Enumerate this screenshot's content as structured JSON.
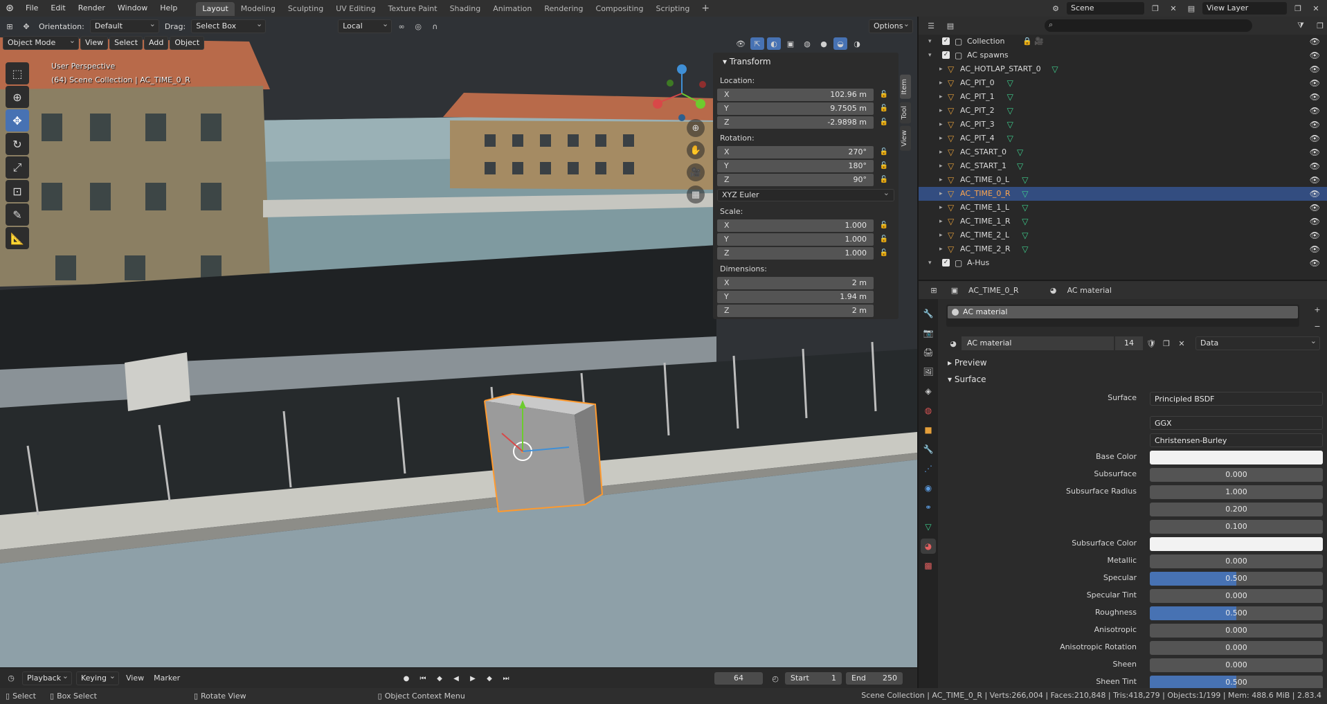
{
  "topbar": {
    "menus": [
      "File",
      "Edit",
      "Render",
      "Window",
      "Help"
    ],
    "workspaces": [
      "Layout",
      "Modeling",
      "Sculpting",
      "UV Editing",
      "Texture Paint",
      "Shading",
      "Animation",
      "Rendering",
      "Compositing",
      "Scripting"
    ],
    "active_workspace": "Layout",
    "scene": "Scene",
    "view_layer": "View Layer"
  },
  "viewport": {
    "orientation_label": "Orientation:",
    "orientation_value": "Default",
    "drag_label": "Drag:",
    "drag_value": "Select Box",
    "transform_space": "Local",
    "options": "Options",
    "mode": "Object Mode",
    "menus": [
      "View",
      "Select",
      "Add",
      "Object"
    ],
    "info_line1": "User Perspective",
    "info_line2": "(64) Scene Collection | AC_TIME_0_R"
  },
  "transform": {
    "title": "Transform",
    "location_label": "Location:",
    "location": {
      "x": "102.96 m",
      "y": "9.7505 m",
      "z": "-2.9898 m"
    },
    "rotation_label": "Rotation:",
    "rotation": {
      "x": "270°",
      "y": "180°",
      "z": "90°"
    },
    "rotation_mode": "XYZ Euler",
    "scale_label": "Scale:",
    "scale": {
      "x": "1.000",
      "y": "1.000",
      "z": "1.000"
    },
    "dimensions_label": "Dimensions:",
    "dimensions": {
      "x": "2 m",
      "y": "1.94 m",
      "z": "2 m"
    },
    "axes": {
      "x": "X",
      "y": "Y",
      "z": "Z"
    },
    "side_tabs": [
      "Item",
      "Tool",
      "View"
    ]
  },
  "timeline": {
    "menus": [
      "Playback",
      "Keying",
      "View",
      "Marker"
    ],
    "current_frame": "64",
    "start_label": "Start",
    "start": "1",
    "end_label": "End",
    "end": "250"
  },
  "statusbar": {
    "select": "Select",
    "box_select": "Box Select",
    "rotate_view": "Rotate View",
    "context_menu": "Object Context Menu",
    "stats": "Scene Collection | AC_TIME_0_R | Verts:266,004 | Faces:210,848 | Tris:418,279 | Objects:1/199 | Mem: 488.6 MiB | 2.83.4"
  },
  "outliner": {
    "rows": [
      {
        "name": "Collection",
        "kind": "collection",
        "indent": 0,
        "selected": false
      },
      {
        "name": "AC spawns",
        "kind": "collection",
        "indent": 0,
        "selected": false
      },
      {
        "name": "AC_HOTLAP_START_0",
        "kind": "object",
        "indent": 1,
        "selected": false
      },
      {
        "name": "AC_PIT_0",
        "kind": "object",
        "indent": 1,
        "selected": false
      },
      {
        "name": "AC_PIT_1",
        "kind": "object",
        "indent": 1,
        "selected": false
      },
      {
        "name": "AC_PIT_2",
        "kind": "object",
        "indent": 1,
        "selected": false
      },
      {
        "name": "AC_PIT_3",
        "kind": "object",
        "indent": 1,
        "selected": false
      },
      {
        "name": "AC_PIT_4",
        "kind": "object",
        "indent": 1,
        "selected": false
      },
      {
        "name": "AC_START_0",
        "kind": "object",
        "indent": 1,
        "selected": false
      },
      {
        "name": "AC_START_1",
        "kind": "object",
        "indent": 1,
        "selected": false
      },
      {
        "name": "AC_TIME_0_L",
        "kind": "object",
        "indent": 1,
        "selected": false
      },
      {
        "name": "AC_TIME_0_R",
        "kind": "object",
        "indent": 1,
        "selected": true
      },
      {
        "name": "AC_TIME_1_L",
        "kind": "object",
        "indent": 1,
        "selected": false
      },
      {
        "name": "AC_TIME_1_R",
        "kind": "object",
        "indent": 1,
        "selected": false
      },
      {
        "name": "AC_TIME_2_L",
        "kind": "object",
        "indent": 1,
        "selected": false
      },
      {
        "name": "AC_TIME_2_R",
        "kind": "object",
        "indent": 1,
        "selected": false
      },
      {
        "name": "A-Hus",
        "kind": "collection",
        "indent": 0,
        "selected": false
      }
    ]
  },
  "properties": {
    "object_name": "AC_TIME_0_R",
    "material_name": "AC material",
    "slot_name": "AC material",
    "material_field": "AC material",
    "users": "14",
    "link": "Data",
    "preview": "Preview",
    "surface_panel": "Surface",
    "rows": [
      {
        "label": "Surface",
        "value": "Principled BSDF",
        "style": "dark"
      },
      {
        "label": "",
        "value": "GGX",
        "style": "dark"
      },
      {
        "label": "",
        "value": "Christensen-Burley",
        "style": "dark"
      },
      {
        "label": "Base Color",
        "value": "",
        "style": "white"
      },
      {
        "label": "Subsurface",
        "value": "0.000",
        "style": "num",
        "fill": 0
      },
      {
        "label": "Subsurface Radius",
        "value": "1.000",
        "style": "num",
        "fill": 0
      },
      {
        "label": "",
        "value": "0.200",
        "style": "num",
        "fill": 0
      },
      {
        "label": "",
        "value": "0.100",
        "style": "num",
        "fill": 0
      },
      {
        "label": "Subsurface Color",
        "value": "",
        "style": "white"
      },
      {
        "label": "Metallic",
        "value": "0.000",
        "style": "num",
        "fill": 0
      },
      {
        "label": "Specular",
        "value": "0.500",
        "style": "num",
        "fill": 0.5
      },
      {
        "label": "Specular Tint",
        "value": "0.000",
        "style": "num",
        "fill": 0
      },
      {
        "label": "Roughness",
        "value": "0.500",
        "style": "num",
        "fill": 0.5
      },
      {
        "label": "Anisotropic",
        "value": "0.000",
        "style": "num",
        "fill": 0
      },
      {
        "label": "Anisotropic Rotation",
        "value": "0.000",
        "style": "num",
        "fill": 0
      },
      {
        "label": "Sheen",
        "value": "0.000",
        "style": "num",
        "fill": 0
      },
      {
        "label": "Sheen Tint",
        "value": "0.500",
        "style": "num",
        "fill": 0.5
      }
    ]
  },
  "colors": {
    "accent": "#4772b3",
    "selection": "#334d80",
    "active_object": "#ffa64d",
    "object_icon": "#e59f3a",
    "mesh_icon": "#3ecf8e"
  }
}
